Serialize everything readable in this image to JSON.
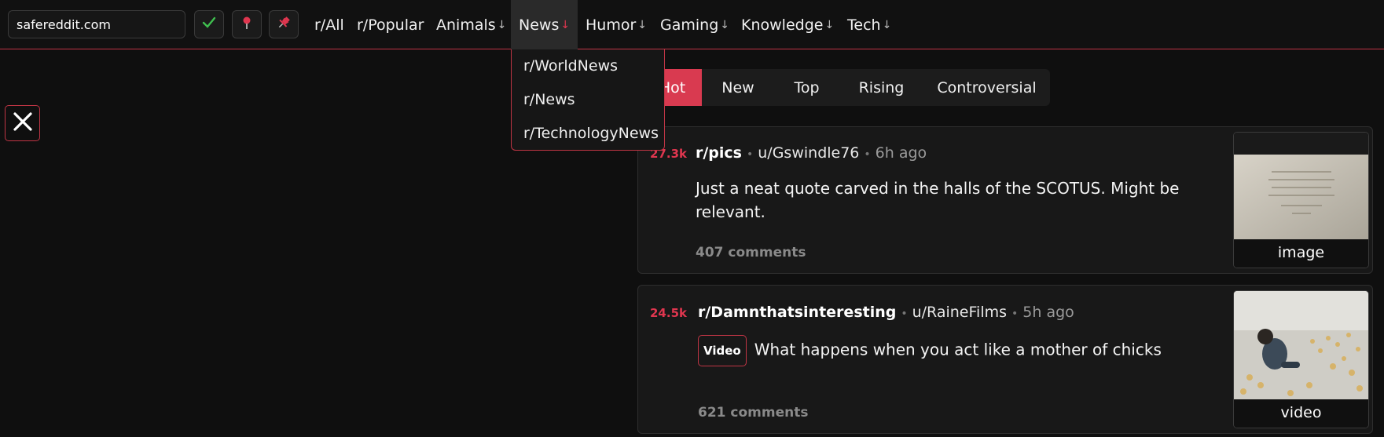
{
  "search": {
    "value": "safereddit.com"
  },
  "toolbar": {
    "check_icon": "check-icon",
    "pin_icon": "map-pin-icon",
    "pushpin_icon": "pushpin-icon"
  },
  "nav": {
    "items": [
      {
        "label": "r/All",
        "arrow": ""
      },
      {
        "label": "r/Popular",
        "arrow": ""
      },
      {
        "label": "Animals",
        "arrow": "↓"
      },
      {
        "label": "News",
        "arrow": "↓"
      },
      {
        "label": "Humor",
        "arrow": "↓"
      },
      {
        "label": "Gaming",
        "arrow": "↓"
      },
      {
        "label": "Knowledge",
        "arrow": "↓"
      },
      {
        "label": "Tech",
        "arrow": "↓"
      }
    ]
  },
  "dropdown": {
    "items": [
      "r/WorldNews",
      "r/News",
      "r/TechnologyNews"
    ]
  },
  "sort": {
    "tabs": [
      "Hot",
      "New",
      "Top",
      "Rising",
      "Controversial"
    ],
    "active": "Hot"
  },
  "posts": [
    {
      "score": "27.3k",
      "subreddit": "r/pics",
      "user": "u/Gswindle76",
      "time": "6h ago",
      "title_line1": "Just a neat quote carved in the halls of the SCOTUS. Might be",
      "title_line2": "relevant.",
      "comments": "407 comments",
      "thumb_label": "image"
    },
    {
      "score": "24.5k",
      "subreddit": "r/Damnthatsinteresting",
      "user": "u/RaineFilms",
      "time": "5h ago",
      "flair": "Video",
      "title": "What happens when you act like a mother of chicks",
      "comments": "621 comments",
      "thumb_label": "video"
    }
  ],
  "colors": {
    "accent": "#d93a50",
    "check": "#3fbf4f",
    "background": "#0f0f0f"
  }
}
